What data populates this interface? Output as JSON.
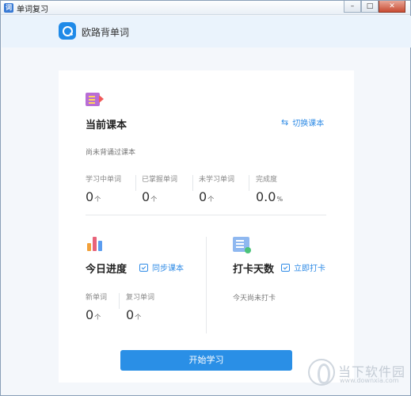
{
  "window": {
    "title": "单词复习",
    "icon_text": "词"
  },
  "app": {
    "name": "欧路背单词"
  },
  "current_book": {
    "title": "当前课本",
    "switch_label": "切换课本",
    "note": "尚未背诵过课本",
    "stats": [
      {
        "label": "学习中单词",
        "value": "0",
        "unit": "个"
      },
      {
        "label": "已掌握单词",
        "value": "0",
        "unit": "个"
      },
      {
        "label": "未学习单词",
        "value": "0",
        "unit": "个"
      },
      {
        "label": "完成度",
        "value": "0.0",
        "unit": "%"
      }
    ]
  },
  "today_progress": {
    "title": "今日进度",
    "sync_label": "同步课本",
    "stats": [
      {
        "label": "新单词",
        "value": "0",
        "unit": "个"
      },
      {
        "label": "复习单词",
        "value": "0",
        "unit": "个"
      }
    ]
  },
  "checkin": {
    "title": "打卡天数",
    "checkin_label": "立即打卡",
    "note": "今天尚未打卡"
  },
  "start_button": "开始学习",
  "watermark": {
    "text": "当下软件园",
    "url": "www.downxia.com"
  },
  "colors": {
    "accent": "#2a8fe6",
    "header_bg": "#eaf3fc"
  }
}
